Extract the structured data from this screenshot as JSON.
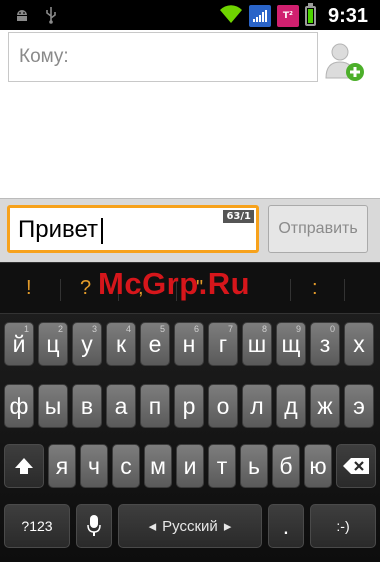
{
  "status_bar": {
    "time": "9:31",
    "icons": [
      "android-debug-icon",
      "usb-icon",
      "wifi-icon",
      "sim1-signal-icon",
      "sim2-signal-icon",
      "battery-charging-icon"
    ],
    "colors": {
      "wifi": "#6fd400",
      "sim1": "#2a64c8",
      "sim2": "#d0206f",
      "battery": "#4cd400"
    },
    "sim2_label": "T²"
  },
  "compose": {
    "to_placeholder": "Кому:",
    "add_contact_icon": "add-contact-icon"
  },
  "input_bar": {
    "message_text": "Привет",
    "counter": "63/1",
    "send_label": "Отправить",
    "accent_color": "#f7a21c"
  },
  "suggestions": [
    "!",
    "?",
    ",",
    "\"",
    ":"
  ],
  "watermark": "McGrp.Ru",
  "keyboard": {
    "row1": [
      {
        "label": "й",
        "sub": "1"
      },
      {
        "label": "ц",
        "sub": "2"
      },
      {
        "label": "у",
        "sub": "3"
      },
      {
        "label": "к",
        "sub": "4"
      },
      {
        "label": "е",
        "sub": "5"
      },
      {
        "label": "н",
        "sub": "6"
      },
      {
        "label": "г",
        "sub": "7"
      },
      {
        "label": "ш",
        "sub": "8"
      },
      {
        "label": "щ",
        "sub": "9"
      },
      {
        "label": "з",
        "sub": "0"
      },
      {
        "label": "х",
        "sub": ""
      }
    ],
    "row2": [
      "ф",
      "ы",
      "в",
      "а",
      "п",
      "р",
      "о",
      "л",
      "д",
      "ж",
      "э"
    ],
    "row3": [
      "я",
      "ч",
      "с",
      "м",
      "и",
      "т",
      "ь",
      "б",
      "ю"
    ],
    "shift_icon": "shift-icon",
    "backspace_icon": "backspace-icon",
    "symbols_label": "?123",
    "mic_icon": "microphone-icon",
    "language_label": "Русский",
    "period_label": ".",
    "smiley_label": ":-)"
  }
}
